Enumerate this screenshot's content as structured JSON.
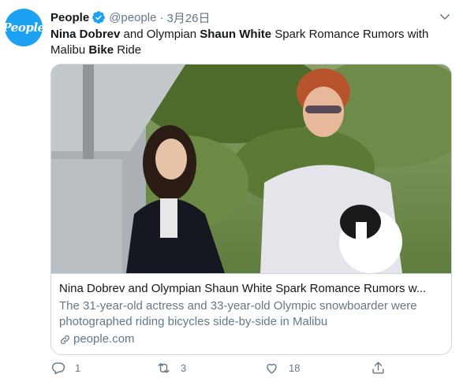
{
  "author": {
    "display_name": "People",
    "handle": "@people",
    "separator": "·",
    "date": "3月26日",
    "avatar_text": "People"
  },
  "tweet": {
    "text_parts": [
      {
        "text": "Nina Dobrev",
        "bold": true
      },
      {
        "text": " and Olympian ",
        "bold": false
      },
      {
        "text": "Shaun White",
        "bold": true
      },
      {
        "text": " Spark Romance Rumors with Malibu ",
        "bold": false
      },
      {
        "text": "Bike",
        "bold": true
      },
      {
        "text": " Ride",
        "bold": false
      }
    ]
  },
  "card": {
    "title": "Nina Dobrev and Olympian Shaun White Spark Romance Rumors w...",
    "description": "The 31-year-old actress and 33-year-old Olympic snowboarder were photographed riding bicycles side-by-side in Malibu",
    "domain": "people.com",
    "domain_icon": "link-icon"
  },
  "actions": {
    "reply_count": "1",
    "retweet_count": "3",
    "like_count": "18"
  },
  "colors": {
    "brand_blue": "#1da1f2",
    "text_primary": "#14171a",
    "text_secondary": "#657786",
    "border": "#ccd6dd"
  }
}
